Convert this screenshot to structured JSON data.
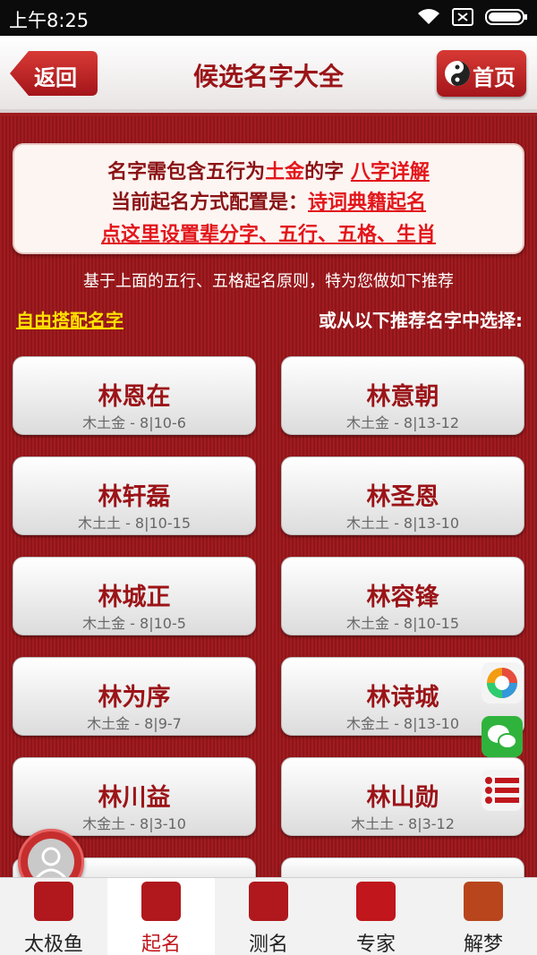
{
  "status": {
    "time": "上午8:25"
  },
  "header": {
    "back_label": "返回",
    "title": "候选名字大全",
    "home_label": "首页"
  },
  "info": {
    "line1_prefix": "名字需包含五行为",
    "line1_elements": "土金",
    "line1_mid": "的字",
    "line1_link": "八字详解",
    "line2_prefix": "当前起名方式配置是：",
    "line2_link": "诗词典籍起名",
    "line3_link": "点这里设置辈分字、五行、五格、生肖"
  },
  "tip": "基于上面的五行、五格起名原则，特为您做如下推荐",
  "free_link": "自由搭配名字",
  "choose_label": "或从以下推荐名字中选择:",
  "names": [
    {
      "name": "林恩在",
      "meta": "木土金 - 8|10-6"
    },
    {
      "name": "林意朝",
      "meta": "木土金 - 8|13-12"
    },
    {
      "name": "林轩磊",
      "meta": "木土土 - 8|10-15"
    },
    {
      "name": "林圣恩",
      "meta": "木土土 - 8|13-10"
    },
    {
      "name": "林城正",
      "meta": "木土金 - 8|10-5"
    },
    {
      "name": "林容锋",
      "meta": "木土金 - 8|10-15"
    },
    {
      "name": "林为序",
      "meta": "木土金 - 8|9-7"
    },
    {
      "name": "林诗城",
      "meta": "木金土 - 8|13-10"
    },
    {
      "name": "林川益",
      "meta": "木金土 - 8|3-10"
    },
    {
      "name": "林山勋",
      "meta": "木土土 - 8|3-12"
    }
  ],
  "tabs": [
    {
      "label": "太极鱼",
      "icon": "taiji-fish-icon"
    },
    {
      "label": "起名",
      "icon": "naming-icon"
    },
    {
      "label": "测名",
      "icon": "name-test-icon"
    },
    {
      "label": "专家",
      "icon": "yin-yang-icon"
    },
    {
      "label": "解梦",
      "icon": "dream-icon"
    }
  ],
  "colors": {
    "brand_red": "#9e1b1e",
    "accent_red": "#e2161b",
    "link_yellow": "#ffe100"
  }
}
